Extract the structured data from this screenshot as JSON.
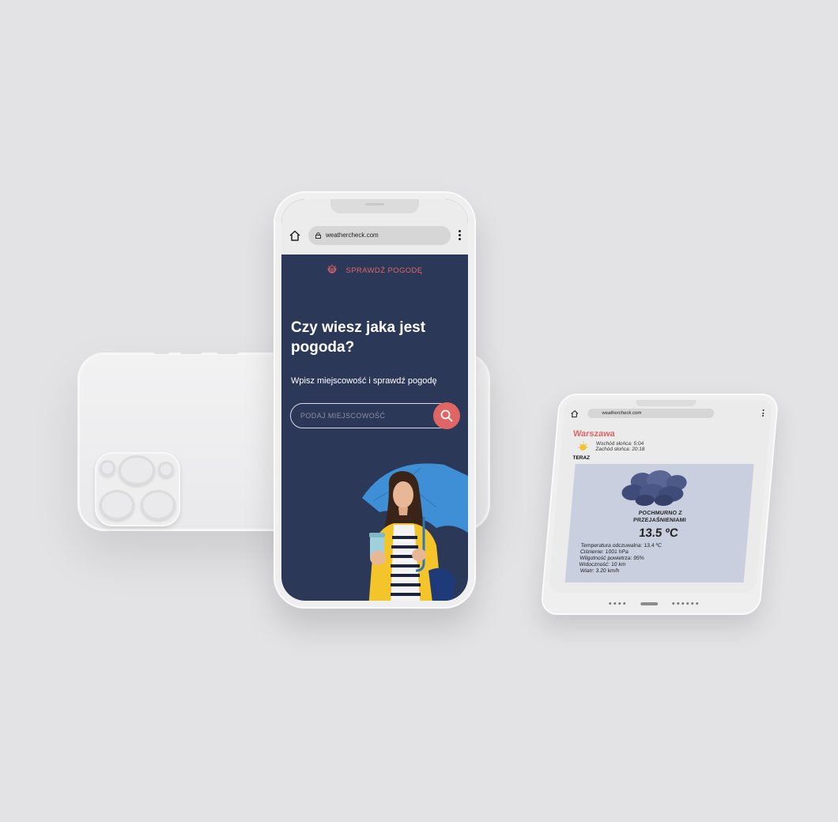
{
  "colors": {
    "background": "#e3e3e5",
    "navy": "#2c3857",
    "accent": "#e06666",
    "card": "#c9cfdf"
  },
  "main_phone": {
    "browser": {
      "home_icon": "home-icon",
      "url": "weathercheck.com",
      "menu_icon": "more-vert-icon"
    },
    "brand_label": "SPRAWDŹ POGODĘ",
    "hero_title": "Czy wiesz jaka jest pogoda?",
    "hero_subtitle": "Wpisz miejscowość i sprawdź pogodę",
    "search": {
      "placeholder": "PODAJ MIEJSCOWOŚĆ",
      "button_icon": "search-icon"
    }
  },
  "right_phone": {
    "browser": {
      "url": "weathercheck.com"
    },
    "city": "Warszawa",
    "sunrise": "Wschód słońca: 5:04",
    "sunset": "Zachód słońca: 20:18",
    "now_label": "TERAZ",
    "condition": "POCHMURNO Z PRZEJAŚNIENIAMI",
    "temperature": "13.5 ºC",
    "details": [
      "Temperatura odczuwalna: 13.4 ºC",
      "Ciśnienie: 1001 hPa",
      "Wilgotność powietrza: 95%",
      "Widoczność: 10 km",
      "Wiatr: 3.20 km/h"
    ]
  }
}
